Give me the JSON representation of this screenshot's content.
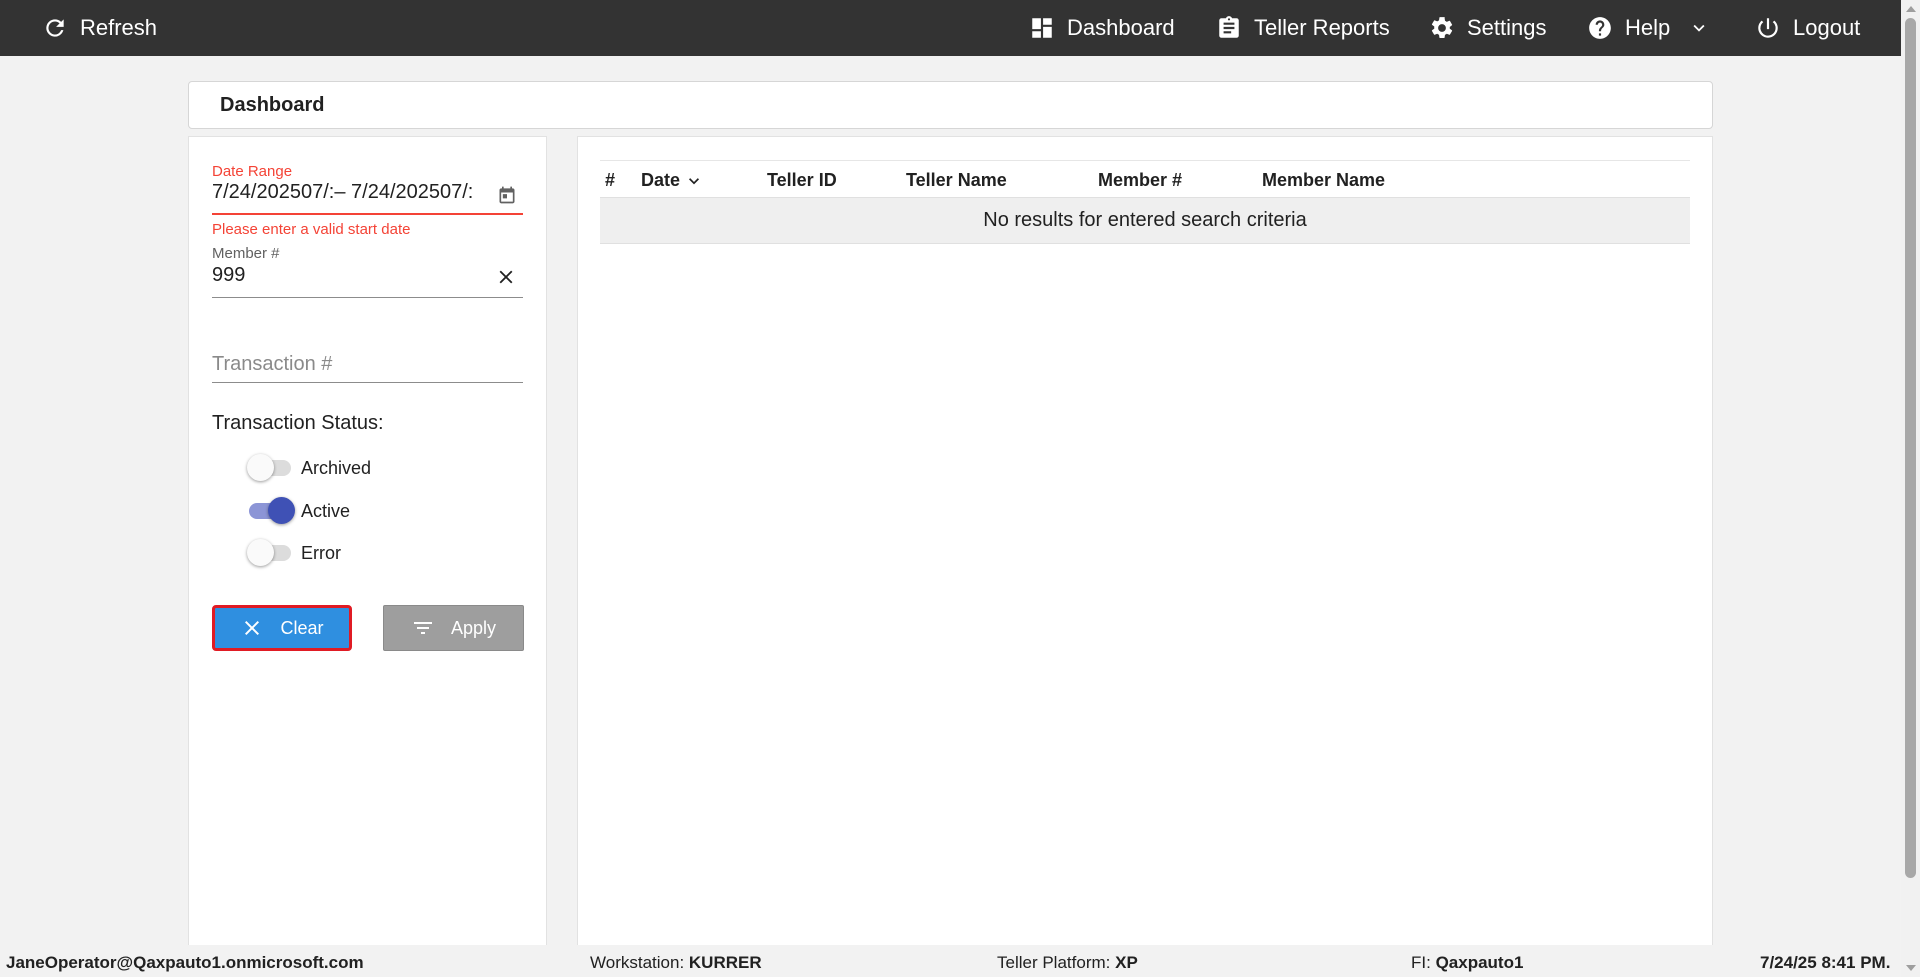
{
  "topbar": {
    "refresh_label": "Refresh",
    "dashboard_label": "Dashboard",
    "teller_reports_label": "Teller Reports",
    "settings_label": "Settings",
    "help_label": "Help",
    "logout_label": "Logout",
    "background": "#333333"
  },
  "page": {
    "title": "Dashboard"
  },
  "filters": {
    "date_range_label": "Date Range",
    "date_range_value": "7/24/202507/:– 7/24/202507/:",
    "date_error": "Please enter a valid start date",
    "member_label": "Member #",
    "member_value": "999",
    "transaction_placeholder": "Transaction #",
    "status_label": "Transaction Status:",
    "statuses": [
      {
        "label": "Archived",
        "on": false
      },
      {
        "label": "Active",
        "on": true
      },
      {
        "label": "Error",
        "on": false
      }
    ],
    "clear_label": "Clear",
    "apply_label": "Apply"
  },
  "table": {
    "columns": [
      "#",
      "Date",
      "Teller ID",
      "Teller Name",
      "Member #",
      "Member Name"
    ],
    "empty_message": "No results for entered search criteria"
  },
  "footer": {
    "user": "JaneOperator@Qaxpauto1.onmicrosoft.com",
    "workstation_label": "Workstation:",
    "workstation_value": "KURRER",
    "platform_label": "Teller Platform:",
    "platform_value": "XP",
    "fi_label": "FI:",
    "fi_value": "Qaxpauto1",
    "datetime": "7/24/25 8:41 PM."
  },
  "colors": {
    "accent_blue": "#2f8fe0",
    "toggle_on": "#3f51b5",
    "error_red": "#f44336",
    "focus_outline": "#e01b24"
  }
}
